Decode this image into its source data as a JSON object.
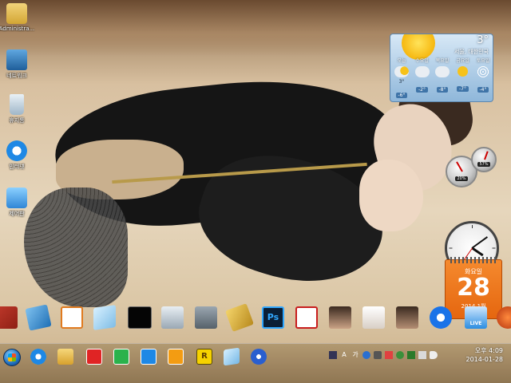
{
  "desktop": {
    "icons": [
      {
        "label": "Administra..."
      },
      {
        "label": "네트워크"
      },
      {
        "label": "휴지통"
      },
      {
        "label": "인터넷"
      },
      {
        "label": "제어판"
      }
    ]
  },
  "weather": {
    "current_temp": "3°",
    "city": "서울, 대한민국",
    "days": [
      {
        "name": "오늘",
        "high": "3°",
        "low": "-6°",
        "icon": "cloud-sun-icon"
      },
      {
        "name": "수요일",
        "high": "",
        "low": "-2°",
        "icon": "cloud-icon"
      },
      {
        "name": "목요일",
        "high": "",
        "low": "-8°",
        "icon": "cloud-icon"
      },
      {
        "name": "금요일",
        "high": "",
        "low": "-7°",
        "icon": "sun-icon"
      },
      {
        "name": "토요일",
        "high": "",
        "low": "-4°",
        "icon": "snow-icon"
      }
    ]
  },
  "meters": {
    "cpu_percent": "20%",
    "memory_percent": "57%"
  },
  "calendar": {
    "weekday": "화요일",
    "day": "28",
    "year_month": "2014 1월"
  },
  "dock": {
    "icons": [
      "winrar-icon",
      "text-editor-icon",
      "search-tool-icon",
      "notepad-icon",
      "black-screen-icon",
      "computer-icon",
      "toolbox-icon",
      "tools-icon"
    ],
    "photoshop_label": "Ps",
    "live_label": "LIVE"
  },
  "taskbar": {
    "time": "오후 4:09",
    "date": "2014-01-28",
    "tray_labels": [
      "A",
      "가"
    ],
    "pinned_r_label": "R"
  },
  "colors": {
    "calendar": "#e5660f",
    "taskbar": "#9a7d55",
    "weather_panel": "#8fb7da"
  }
}
